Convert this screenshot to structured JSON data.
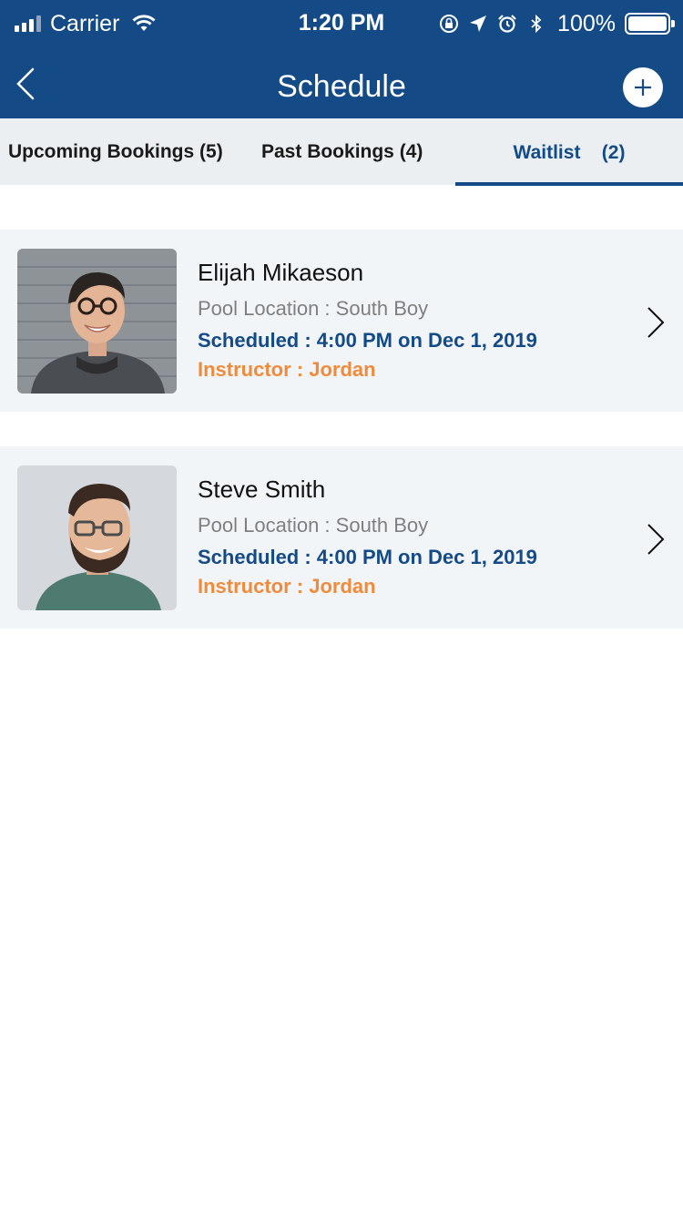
{
  "status_bar": {
    "carrier": "Carrier",
    "time": "1:20 PM",
    "battery": "100%",
    "icons": [
      "signal-icon",
      "wifi-icon",
      "screen-lock-icon",
      "location-arrow-icon",
      "alarm-icon",
      "bluetooth-icon",
      "battery-icon"
    ]
  },
  "nav": {
    "title": "Schedule",
    "back_icon": "chevron-left-icon",
    "add_icon": "plus-icon"
  },
  "tabs": [
    {
      "label": "Upcoming Bookings",
      "count": "(5)",
      "selected": false
    },
    {
      "label": "Past Bookings",
      "count": "(4)",
      "selected": false
    },
    {
      "label": "Waitlist",
      "count": "(2)",
      "selected": true
    }
  ],
  "bookings": [
    {
      "name": "Elijah Mikaeson",
      "location": "Pool Location : South Boy",
      "scheduled": "Scheduled : 4:00 PM on Dec 1, 2019",
      "instructor": "Instructor : Jordan"
    },
    {
      "name": "Steve Smith",
      "location": "Pool Location : South Boy",
      "scheduled": "Scheduled : 4:00 PM on Dec 1, 2019",
      "instructor": "Instructor : Jordan"
    }
  ],
  "colors": {
    "brand": "#144b87",
    "accent_orange": "#f08b3c",
    "muted_text": "#7f7f7f",
    "card_bg": "#f2f5f8",
    "tab_bg": "#eceff2"
  }
}
